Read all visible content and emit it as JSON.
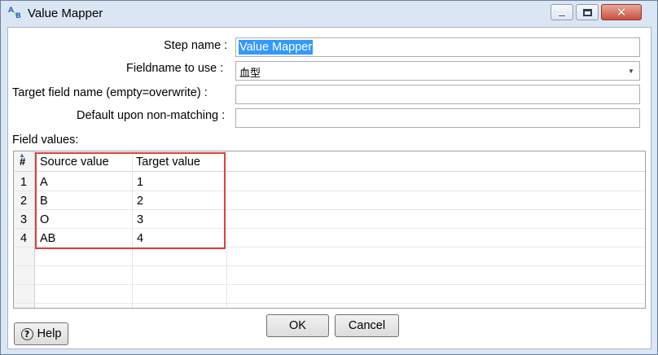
{
  "window": {
    "title": "Value Mapper"
  },
  "form": {
    "step_name_label": "Step name :",
    "step_name_value": "Value Mapper",
    "fieldname_label": "Fieldname to use :",
    "fieldname_value": "血型",
    "target_label": "Target field name (empty=overwrite) :",
    "target_value": "",
    "default_label": "Default upon non-matching :",
    "default_value": ""
  },
  "grid": {
    "section_label": "Field values:",
    "headers": {
      "num": "#",
      "source": "Source value",
      "target": "Target value"
    },
    "rows": [
      {
        "num": "1",
        "source": "A",
        "target": "1"
      },
      {
        "num": "2",
        "source": "B",
        "target": "2"
      },
      {
        "num": "3",
        "source": "O",
        "target": "3"
      },
      {
        "num": "4",
        "source": "AB",
        "target": "4"
      }
    ]
  },
  "buttons": {
    "ok": "OK",
    "cancel": "Cancel",
    "help": "Help"
  },
  "colors": {
    "highlight": "#d9413f",
    "selection": "#3399ff"
  }
}
